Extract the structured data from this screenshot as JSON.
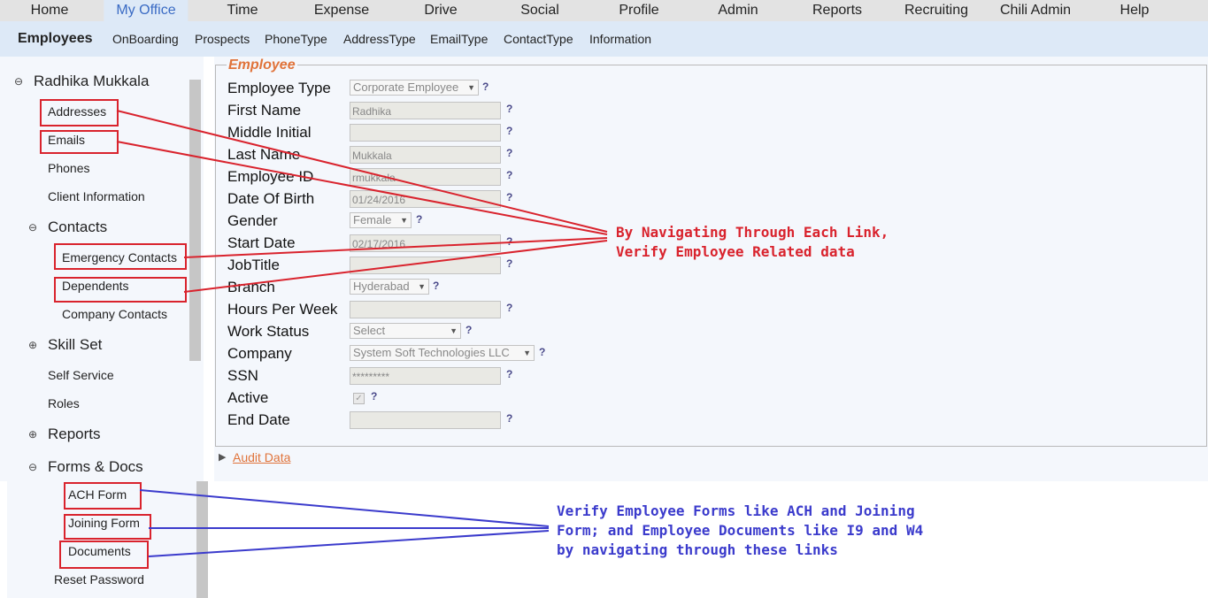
{
  "top_nav": [
    "Home",
    "My Office",
    "Time",
    "Expense",
    "Drive",
    "Social",
    "Profile",
    "Admin",
    "Reports",
    "Recruiting",
    "Chili Admin",
    "Help"
  ],
  "active_top_nav": "My Office",
  "sub_nav": [
    "Employees",
    "OnBoarding",
    "Prospects",
    "PhoneType",
    "AddressType",
    "EmailType",
    "ContactType",
    "Information"
  ],
  "sidebar": {
    "employee_name": "Radhika Mukkala",
    "addresses": "Addresses",
    "emails": "Emails",
    "phones": "Phones",
    "client_information": "Client Information",
    "contacts": "Contacts",
    "emergency_contacts": "Emergency Contacts",
    "dependents": "Dependents",
    "company_contacts": "Company Contacts",
    "skill_set": "Skill Set",
    "self_service": "Self Service",
    "roles": "Roles",
    "reports": "Reports",
    "forms_docs": "Forms & Docs",
    "ach_form": "ACH Form",
    "joining_form": "Joining Form",
    "documents": "Documents",
    "reset_password": "Reset Password",
    "collapse_symbol": "⊖",
    "expand_symbol": "⊕"
  },
  "form": {
    "legend": "Employee",
    "help_symbol": "?",
    "employee_type": {
      "label": "Employee Type",
      "value": "Corporate Employee"
    },
    "first_name": {
      "label": "First Name",
      "value": "Radhika"
    },
    "middle_initial": {
      "label": "Middle Initial",
      "value": ""
    },
    "last_name": {
      "label": "Last Name",
      "value": "Mukkala"
    },
    "employee_id": {
      "label": "Employee ID",
      "value": "rmukkala"
    },
    "date_of_birth": {
      "label": "Date Of Birth",
      "value": "01/24/2016"
    },
    "gender": {
      "label": "Gender",
      "value": "Female"
    },
    "start_date": {
      "label": "Start Date",
      "value": "02/17/2016"
    },
    "job_title": {
      "label": "JobTitle",
      "value": ""
    },
    "branch": {
      "label": "Branch",
      "value": "Hyderabad"
    },
    "hours_per_week": {
      "label": "Hours Per Week",
      "value": ""
    },
    "work_status": {
      "label": "Work Status",
      "value": "Select"
    },
    "company": {
      "label": "Company",
      "value": "System Soft Technologies LLC"
    },
    "ssn": {
      "label": "SSN",
      "value": "*********"
    },
    "active": {
      "label": "Active",
      "checked": true
    },
    "end_date": {
      "label": "End Date",
      "value": ""
    }
  },
  "audit_link": "Audit Data",
  "annotations": {
    "red_line1": "By Navigating Through Each Link,",
    "red_line2": "Verify Employee Related data",
    "blue_line1": "Verify Employee Forms like ACH and Joining",
    "blue_line2": "Form; and Employee Documents like I9 and W4",
    "blue_line3": "by navigating through these links"
  },
  "colors": {
    "annotation_red": "#d9232d",
    "annotation_blue": "#3b3bcc",
    "legend_orange": "#e0733a",
    "nav_active": "#3a6bc4",
    "subnav_bg": "#dde9f7"
  }
}
